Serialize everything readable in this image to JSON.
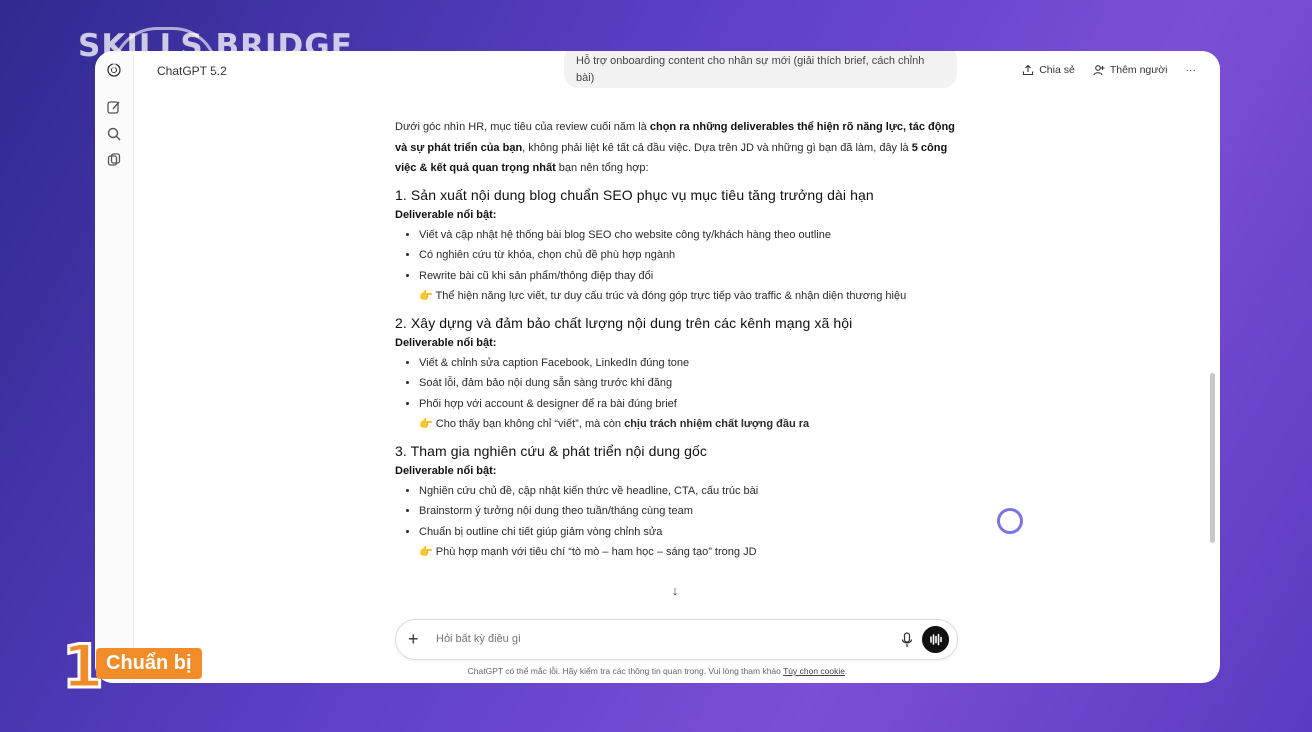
{
  "overlay": {
    "logo_text": "SKILLS BRIDGE",
    "step_number": "1",
    "step_label": "Chuẩn bị"
  },
  "app": {
    "title": "ChatGPT 5.2",
    "share_label": "Chia sẻ",
    "add_people_label": "Thêm người",
    "more_label": "···"
  },
  "user_message": "Hỗ trợ onboarding content cho nhân sự mới (giải thích brief, cách chỉnh bài)",
  "response": {
    "intro_1": "Dưới góc nhìn HR, mục tiêu của review cuối năm là ",
    "intro_b1": "chọn ra những deliverables thể hiện rõ năng lực, tác động và sự phát triển của bạn",
    "intro_2": ", không phải liệt kê tất cả đầu việc. Dựa trên JD và những gì bạn đã làm, đây là ",
    "intro_b2": "5 công việc & kết quả quan trọng nhất",
    "intro_3": " bạn nên tổng hợp:",
    "sections": [
      {
        "heading": "1. Sản xuất nội dung blog chuẩn SEO phục vụ mục tiêu tăng trưởng dài hạn",
        "deliverable_label": "Deliverable nổi bật:",
        "items": [
          "Viết và cập nhật hệ thống bài blog SEO cho website công ty/khách hàng theo outline",
          "Có nghiên cứu từ khóa, chọn chủ đề phù hợp ngành",
          "Rewrite bài cũ khi sản phẩm/thông điệp thay đổi"
        ],
        "note": "👉 Thể hiện năng lực viết, tư duy cấu trúc và đóng góp trực tiếp vào traffic & nhận diện thương hiệu",
        "note_bold": ""
      },
      {
        "heading": "2. Xây dựng và đảm bảo chất lượng nội dung trên các kênh mạng xã hội",
        "deliverable_label": "Deliverable nổi bật:",
        "items": [
          "Viết & chỉnh sửa caption Facebook, LinkedIn đúng tone",
          "Soát lỗi, đảm bảo nội dung sẵn sàng trước khi đăng",
          "Phối hợp với account & designer để ra bài đúng brief"
        ],
        "note": "👉 Cho thấy bạn không chỉ “viết”, mà còn ",
        "note_bold": "chịu trách nhiệm chất lượng đầu ra"
      },
      {
        "heading": "3. Tham gia nghiên cứu & phát triển nội dung gốc",
        "deliverable_label": "Deliverable nổi bật:",
        "items": [
          "Nghiên cứu chủ đề, cập nhật kiến thức về headline, CTA, cấu trúc bài",
          "Brainstorm ý tưởng nội dung theo tuần/tháng cùng team",
          "Chuẩn bị outline chi tiết giúp giảm vòng chỉnh sửa"
        ],
        "note": "👉 Phù hợp mạnh với tiêu chí “tò mò – ham học – sáng tạo” trong JD",
        "note_bold": ""
      }
    ]
  },
  "composer": {
    "placeholder": "Hỏi bất kỳ điều gì"
  },
  "footer": {
    "text": "ChatGPT có thể mắc lỗi. Hãy kiểm tra các thông tin quan trọng. Vui lòng tham khảo ",
    "link": "Tùy chọn cookie",
    "end": "."
  }
}
